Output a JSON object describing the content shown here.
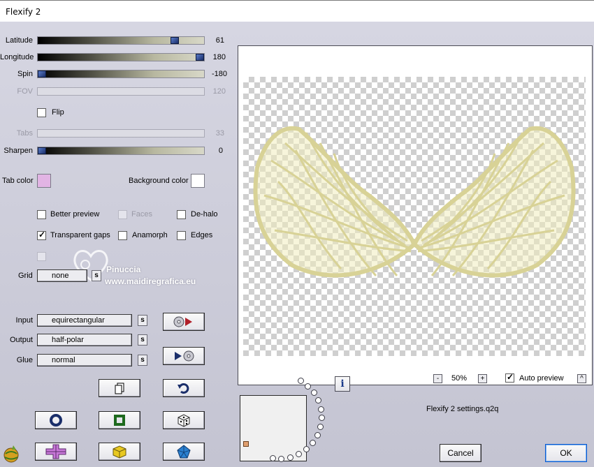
{
  "window": {
    "title": "Flexify 2"
  },
  "sliders": [
    {
      "label": "Latitude",
      "value": "61",
      "fraction": 0.84,
      "enabled": true
    },
    {
      "label": "Longitude",
      "value": "180",
      "fraction": 1.0,
      "enabled": true
    },
    {
      "label": "Spin",
      "value": "-180",
      "fraction": 0.0,
      "enabled": true
    },
    {
      "label": "FOV",
      "value": "120",
      "enabled": false
    },
    {
      "label": "Tabs",
      "value": "33",
      "enabled": false
    },
    {
      "label": "Sharpen",
      "value": "0",
      "fraction": 0.0,
      "enabled": true
    }
  ],
  "flip": {
    "label": "Flip",
    "checked": false
  },
  "colors": {
    "tab_color_label": "Tab color",
    "tab_color": "#e2b4e4",
    "background_color_label": "Background color",
    "background_color": "#ffffff"
  },
  "options": {
    "better_preview": {
      "label": "Better preview",
      "checked": false
    },
    "faces": {
      "label": "Faces",
      "checked": false,
      "enabled": false
    },
    "de_halo": {
      "label": "De-halo",
      "checked": false
    },
    "transparent_gaps": {
      "label": "Transparent gaps",
      "checked": true
    },
    "anamorph": {
      "label": "Anamorph",
      "checked": false
    },
    "edges": {
      "label": "Edges",
      "checked": false
    }
  },
  "grid": {
    "label": "Grid",
    "value": "none",
    "button": "s"
  },
  "watermark": {
    "line1": "Pinuccia",
    "line2": "www.maidiregrafica.eu"
  },
  "projection": {
    "input_label": "Input",
    "input_value": "equirectangular",
    "output_label": "Output",
    "output_value": "half-polar",
    "glue_label": "Glue",
    "glue_value": "normal",
    "s": "s"
  },
  "zoom": {
    "minus": "-",
    "value": "50%",
    "plus": "+"
  },
  "auto_preview": {
    "label": "Auto preview",
    "checked": true,
    "toggle": "^"
  },
  "settings_file": "Flexify 2 settings.q2q",
  "info_button": "i",
  "buttons": {
    "cancel": "Cancel",
    "ok": "OK"
  },
  "accent": {
    "slider_thumb": "#1a2e6a",
    "shape_fill": "#f0edbe",
    "shape_stroke": "#d8d296"
  }
}
